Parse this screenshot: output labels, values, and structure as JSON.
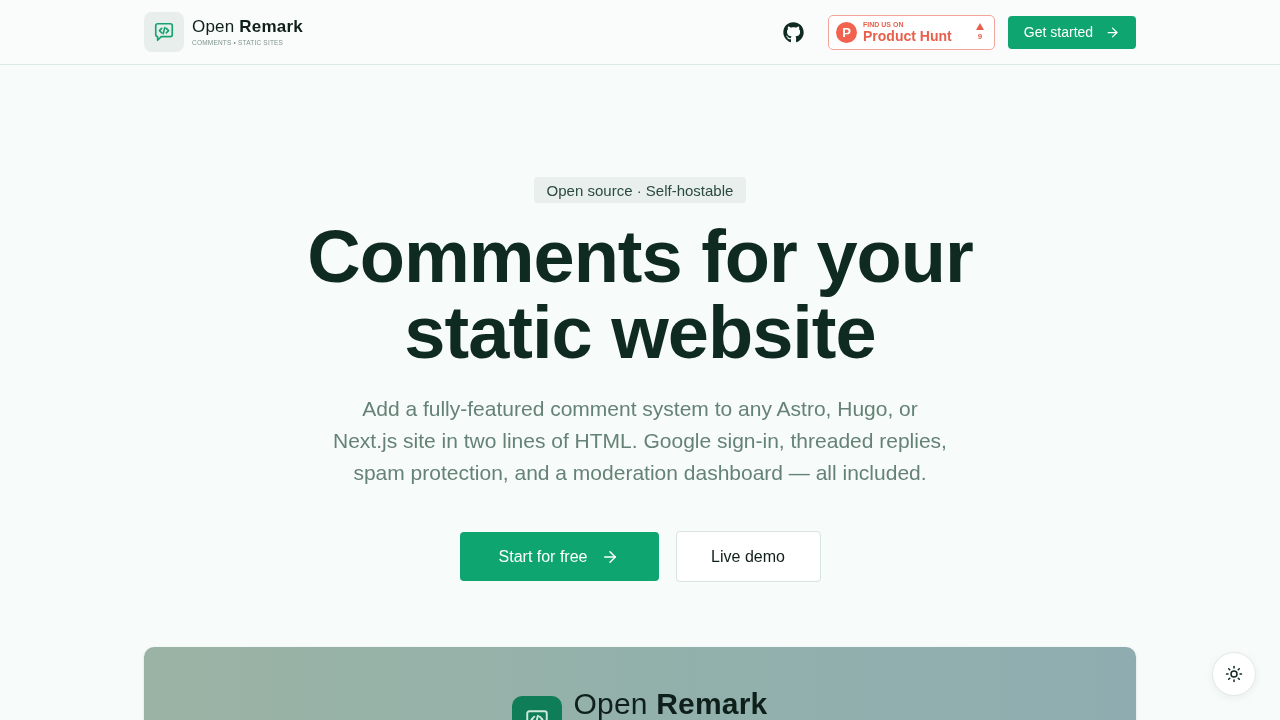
{
  "header": {
    "logo": {
      "name": "Open **Remark**",
      "tagline": "COMMENTS • STATIC SITES"
    },
    "product_hunt": {
      "logo_letter": "P",
      "eyebrow": "FIND US ON",
      "name": "Product Hunt",
      "votes": "9"
    },
    "cta": "Get started"
  },
  "hero": {
    "badge": "Open source · Self-hostable",
    "title": "Comments for your static website",
    "description": "Add a fully-featured comment system to any Astro, Hugo, or Next.js site in two lines of HTML. Google sign-in, threaded replies, spam protection, and a moderation dashboard — all included.",
    "buttons": [
      {
        "label": "Start for free",
        "kind": "primary"
      },
      {
        "label": "Live demo",
        "kind": "secondary"
      }
    ]
  },
  "preview": {
    "logo": {
      "name": "Open **Remark**"
    }
  }
}
